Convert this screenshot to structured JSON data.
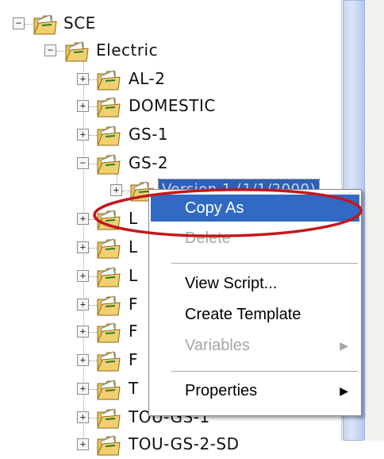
{
  "tree": {
    "nodes": [
      {
        "label": "SCE",
        "expander": "−"
      },
      {
        "label": "Electric",
        "expander": "−"
      },
      {
        "label": "AL-2",
        "expander": "+"
      },
      {
        "label": "DOMESTIC",
        "expander": "+"
      },
      {
        "label": "GS-1",
        "expander": "+"
      },
      {
        "label": "GS-2",
        "expander": "−"
      },
      {
        "label": "Version 1 (1/1/2000)",
        "expander": "+"
      },
      {
        "label": "L",
        "expander": "+"
      },
      {
        "label": "L",
        "expander": "+"
      },
      {
        "label": "L",
        "expander": "+"
      },
      {
        "label": "F",
        "expander": "+"
      },
      {
        "label": "F",
        "expander": "+"
      },
      {
        "label": "F",
        "expander": "+"
      },
      {
        "label": "T",
        "expander": "+"
      },
      {
        "label": "TOU-GS-1",
        "expander": "+"
      },
      {
        "label": "TOU-GS-2-SD",
        "expander": "+"
      }
    ]
  },
  "context_menu": {
    "copy_as": "Copy As",
    "delete": "Delete",
    "view_script": "View Script...",
    "create_template": "Create Template",
    "variables": "Variables",
    "properties": "Properties",
    "submenu_arrow": "▶"
  },
  "colors": {
    "highlight_bar": "#316ac5",
    "annotation_ellipse": "#c4161c",
    "folder_fill": "#f2d070"
  },
  "icons": {
    "folder": "open-folder-icon",
    "expander": "tree-expander-icon"
  }
}
